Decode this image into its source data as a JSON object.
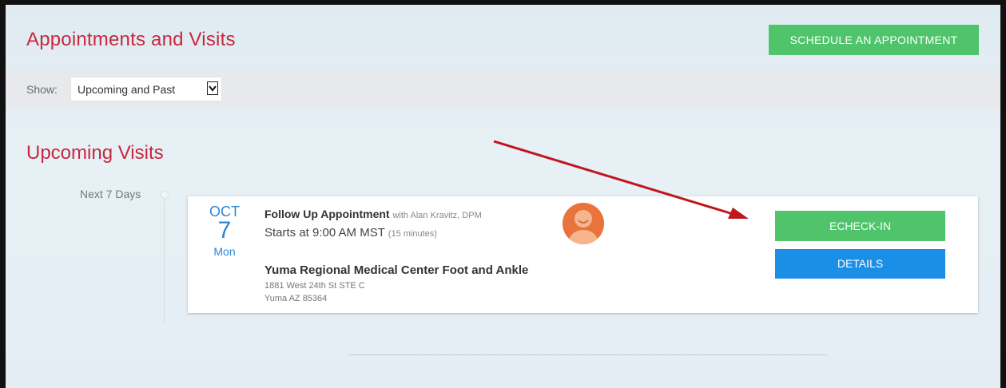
{
  "header": {
    "title": "Appointments and Visits",
    "schedule_label": "SCHEDULE AN APPOINTMENT"
  },
  "filter": {
    "label": "Show:",
    "value": "Upcoming and Past"
  },
  "upcoming": {
    "title": "Upcoming Visits",
    "range_label": "Next 7 Days",
    "visits": [
      {
        "month": "OCT",
        "day": "7",
        "weekday": "Mon",
        "type": "Follow Up Appointment",
        "provider": "with Alan Kravitz, DPM",
        "start": "Starts at 9:00 AM MST",
        "duration": "(15 minutes)",
        "facility": "Yuma Regional Medical Center Foot and Ankle",
        "address_line1": "1881 West 24th St STE C",
        "address_line2": "Yuma AZ 85364",
        "echeckin_label": "ECHECK-IN",
        "details_label": "DETAILS"
      }
    ]
  },
  "colors": {
    "accent_red": "#c8283f",
    "green": "#4fc46a",
    "blue": "#1b8fe6",
    "date_blue": "#2b86d8",
    "avatar_orange": "#e8743b",
    "annotation_arrow": "#c0161c"
  },
  "icons": {
    "select_arrow": "chevron-down-icon",
    "avatar": "user-avatar-icon",
    "annotation": "arrow-annotation"
  }
}
